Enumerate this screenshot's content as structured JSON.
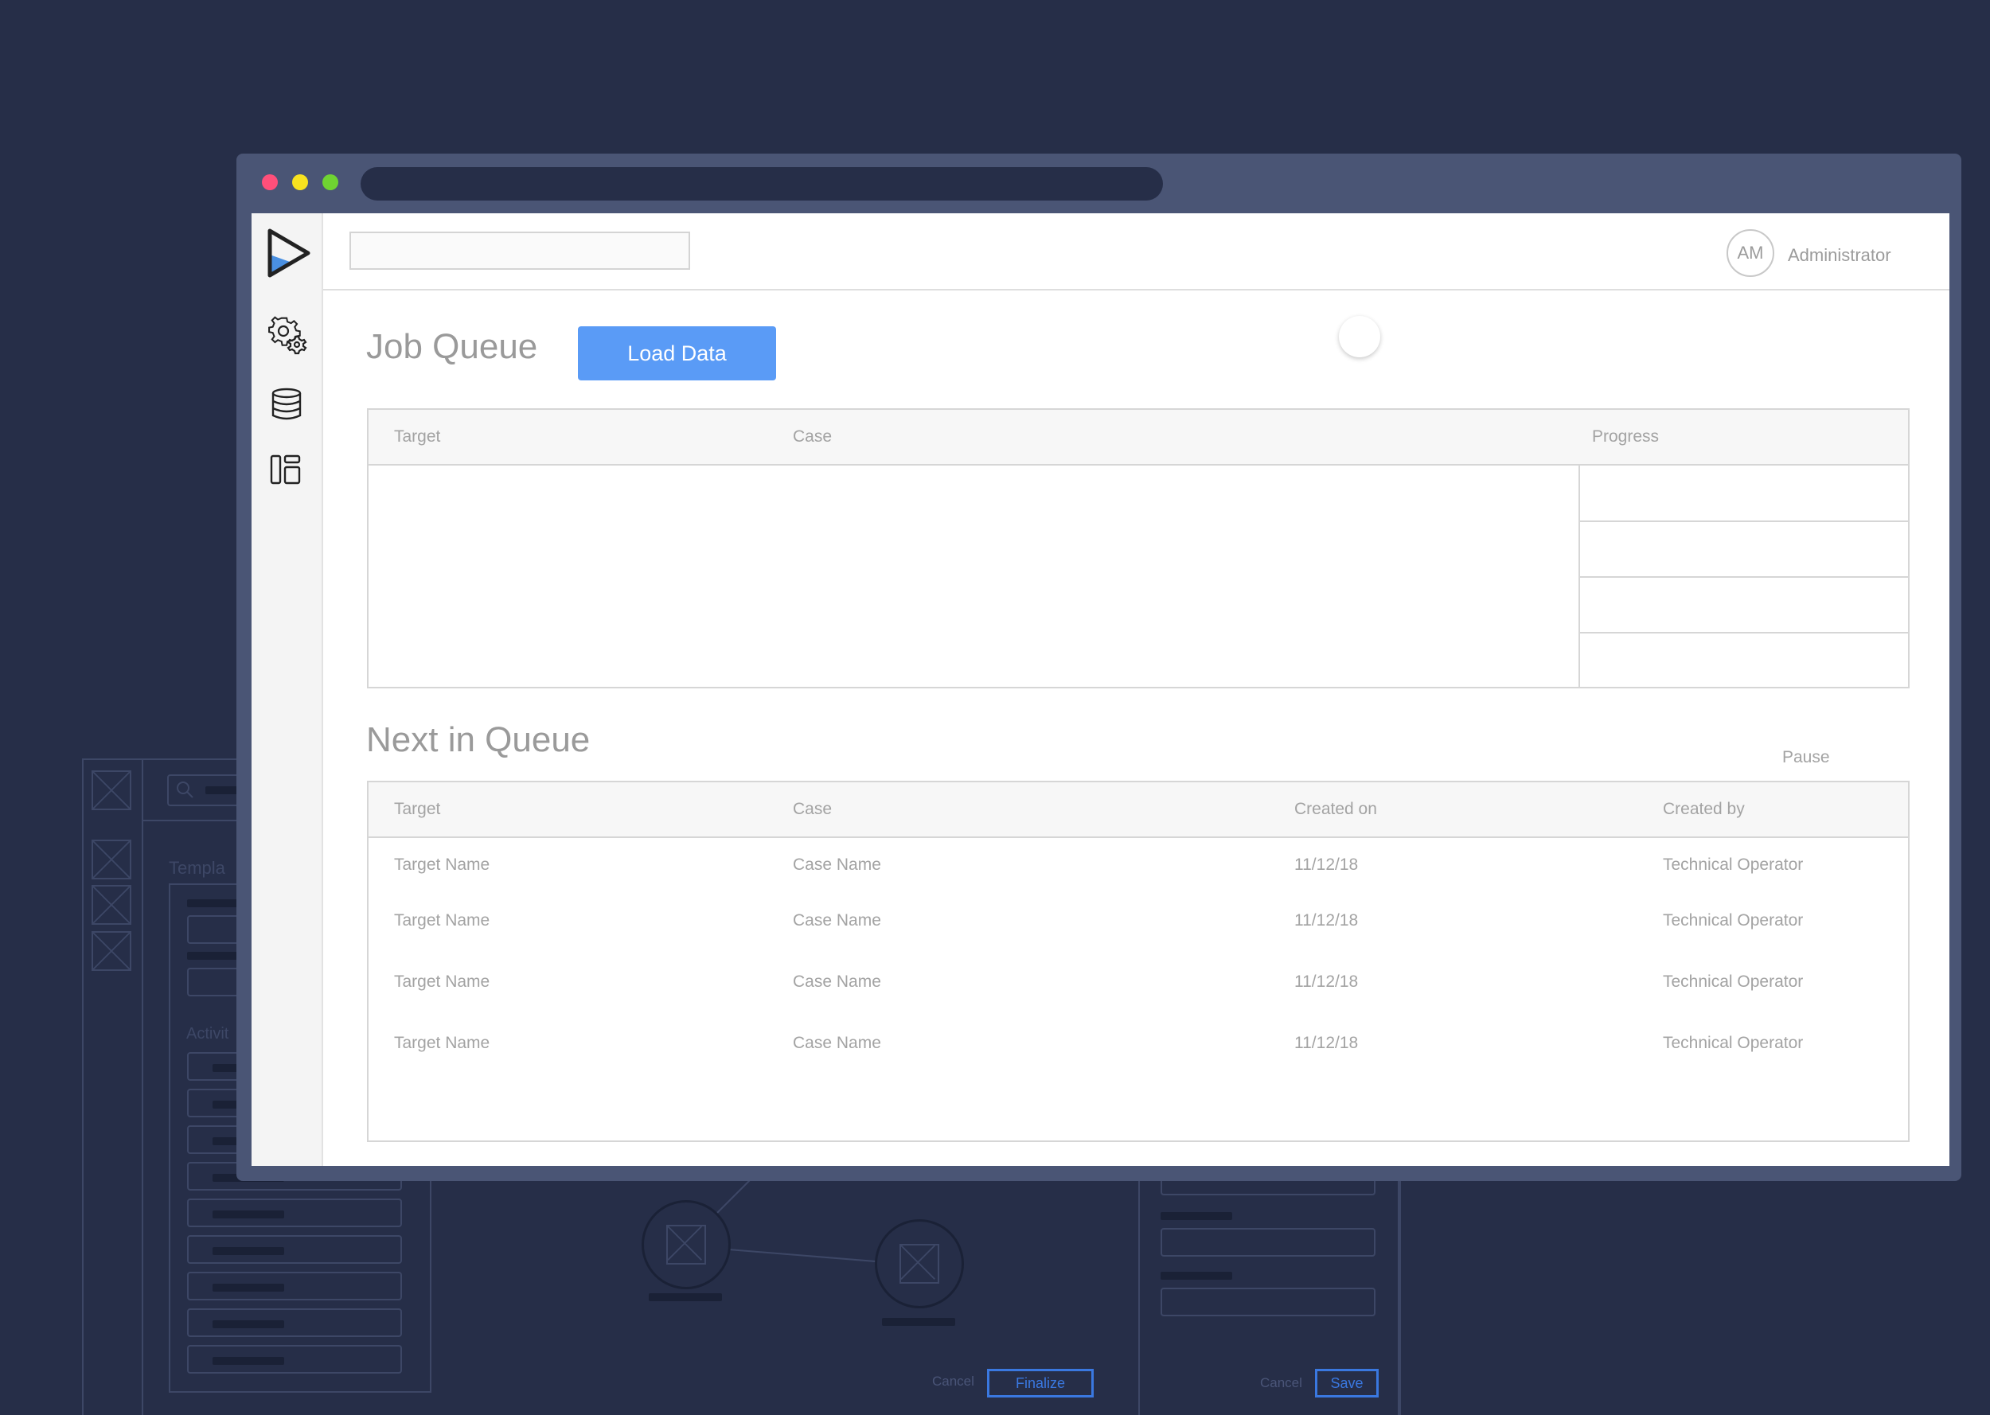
{
  "background_wireframe": {
    "section_labels": [
      "Templa",
      "Activit"
    ],
    "left_cancel_label": "Cancel",
    "finalize_label": "Finalize",
    "right_cancel_label": "Cancel",
    "save_label": "Save"
  },
  "window": {
    "traffic_lights": [
      "#ff4f7a",
      "#f7e21f",
      "#6fd332"
    ]
  },
  "header": {
    "avatar_initials": "AM",
    "user_name": "Administrator"
  },
  "sidebar": {
    "items": [
      {
        "icon": "play-logo-icon"
      },
      {
        "icon": "gears-icon"
      },
      {
        "icon": "database-icon"
      },
      {
        "icon": "dashboard-icon"
      }
    ]
  },
  "job_queue": {
    "title": "Job Queue",
    "load_button": "Load Data",
    "columns": [
      "Target",
      "Case",
      "Progress"
    ],
    "progress_rows": 4
  },
  "next_in_queue": {
    "title": "Next in Queue",
    "pause_label": "Pause",
    "columns": [
      "Target",
      "Case",
      "Created on",
      "Created by"
    ],
    "rows": [
      {
        "target": "Target Name",
        "case": "Case Name",
        "created_on": "11/12/18",
        "created_by": "Technical Operator"
      },
      {
        "target": "Target Name",
        "case": "Case Name",
        "created_on": "11/12/18",
        "created_by": "Technical Operator"
      },
      {
        "target": "Target Name",
        "case": "Case Name",
        "created_on": "11/12/18",
        "created_by": "Technical Operator"
      },
      {
        "target": "Target Name",
        "case": "Case Name",
        "created_on": "11/12/18",
        "created_by": "Technical Operator"
      }
    ]
  },
  "colors": {
    "page_background": "#262e48",
    "window_chrome": "#4a5575",
    "primary_button": "#5a9bf6",
    "wireframe_accent": "#3a78e0"
  }
}
